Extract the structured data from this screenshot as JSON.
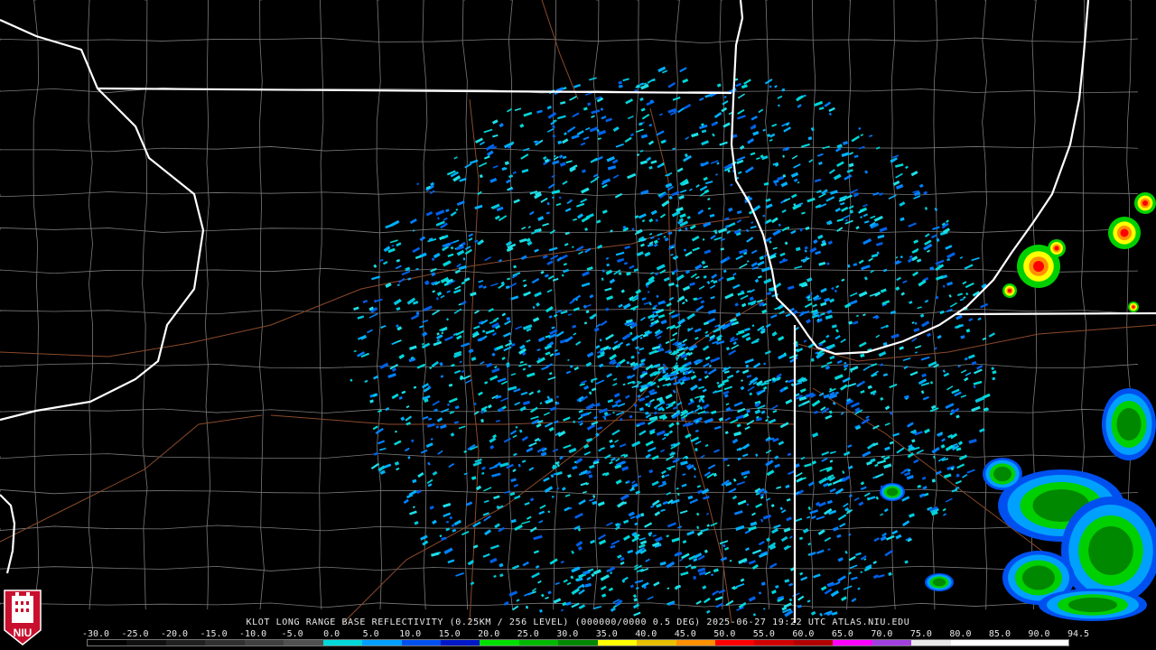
{
  "caption": "KLOT LONG RANGE BASE REFLECTIVITY (0.25KM / 256 LEVEL) (000000/0000 0.5 DEG) 2025-06-27 19:22 UTC  ATLAS.NIU.EDU",
  "colorbar": {
    "labels": [
      "-30.0",
      "-25.0",
      "-20.0",
      "-15.0",
      "-10.0",
      "-5.0",
      "0.0",
      "5.0",
      "10.0",
      "15.0",
      "20.0",
      "25.0",
      "30.0",
      "35.0",
      "40.0",
      "45.0",
      "50.0",
      "55.0",
      "60.0",
      "65.0",
      "70.0",
      "75.0",
      "80.0",
      "85.0",
      "90.0",
      "94.5"
    ],
    "colors": [
      "#000000",
      "#101010",
      "#202020",
      "#303030",
      "#404040",
      "#505050",
      "#00d8d8",
      "#00a0ff",
      "#0050f0",
      "#0018c8",
      "#00e000",
      "#00b800",
      "#008800",
      "#ffff00",
      "#e8c000",
      "#ff9000",
      "#ff0000",
      "#d00000",
      "#b00000",
      "#ff00ff",
      "#a040e0",
      "#e8e8e8",
      "#ffffff",
      "#ffffff",
      "#ffffff"
    ]
  },
  "logo": {
    "text": "NIU"
  },
  "colors": {
    "state_borders": "#ffffff",
    "county_lines": "#8a8a8a",
    "roads": "#8b4a2b",
    "background": "#000000"
  }
}
